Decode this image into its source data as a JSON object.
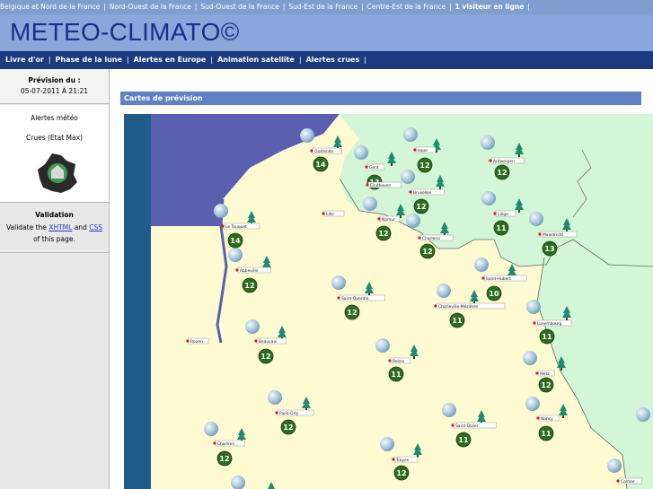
{
  "topbar": {
    "links": [
      "Belgique et Nord de la France",
      "Nord-Ouest de la France",
      "Sud-Ouest de la France",
      "Sud-Est de la France",
      "Centre-Est de la France"
    ],
    "visitors": "1 visiteur en ligne"
  },
  "header": {
    "title": "METEO-CLIMATO©"
  },
  "nav": {
    "items": [
      "Livre d'or",
      "Phase de la lune",
      "Alertes en Europe",
      "Animation satellite",
      "Alertes crues"
    ]
  },
  "sidebar": {
    "forecast_label": "Prévision du :",
    "forecast_date": "05-07-2011 À  21:21",
    "alerts_title": "Alertes météo",
    "floods_label": "Crues (Etat Max)",
    "validation_title": "Validation",
    "validation_prefix": "Validate the",
    "xhtml_link": "XHTML",
    "and": "and",
    "css_link": "CSS",
    "validation_suffix": "of this page."
  },
  "main": {
    "section_title": "Cartes de prévision"
  },
  "map": {
    "colors": {
      "sea": "#5a5fb0",
      "france": "#fefbd2",
      "neighbour": "#d3f6d6",
      "badge": "#2d6b1e"
    },
    "temperature_badges": [
      14,
      12,
      13,
      12,
      12,
      12,
      11,
      14,
      13,
      12,
      12,
      10,
      12,
      11,
      11,
      12,
      11,
      12,
      12,
      11,
      11,
      12,
      12
    ],
    "cities": [
      "Oostende",
      "Gent",
      "Ieper",
      "Antwerpen",
      "Eindhoven",
      "Bruxelles",
      "Liège",
      "Lille",
      "Charleroi",
      "Namur",
      "Le Touquet",
      "Maastricht",
      "Abbeville",
      "Saint-Quentin",
      "Charleville-Mézières",
      "Saint-Hubert",
      "Luxembourg",
      "Beauvais",
      "Rouen",
      "Reims",
      "Metz",
      "Paris-Orly",
      "Nancy",
      "Saint-Dizier",
      "Chartres",
      "Troyes",
      "Colmar"
    ]
  }
}
